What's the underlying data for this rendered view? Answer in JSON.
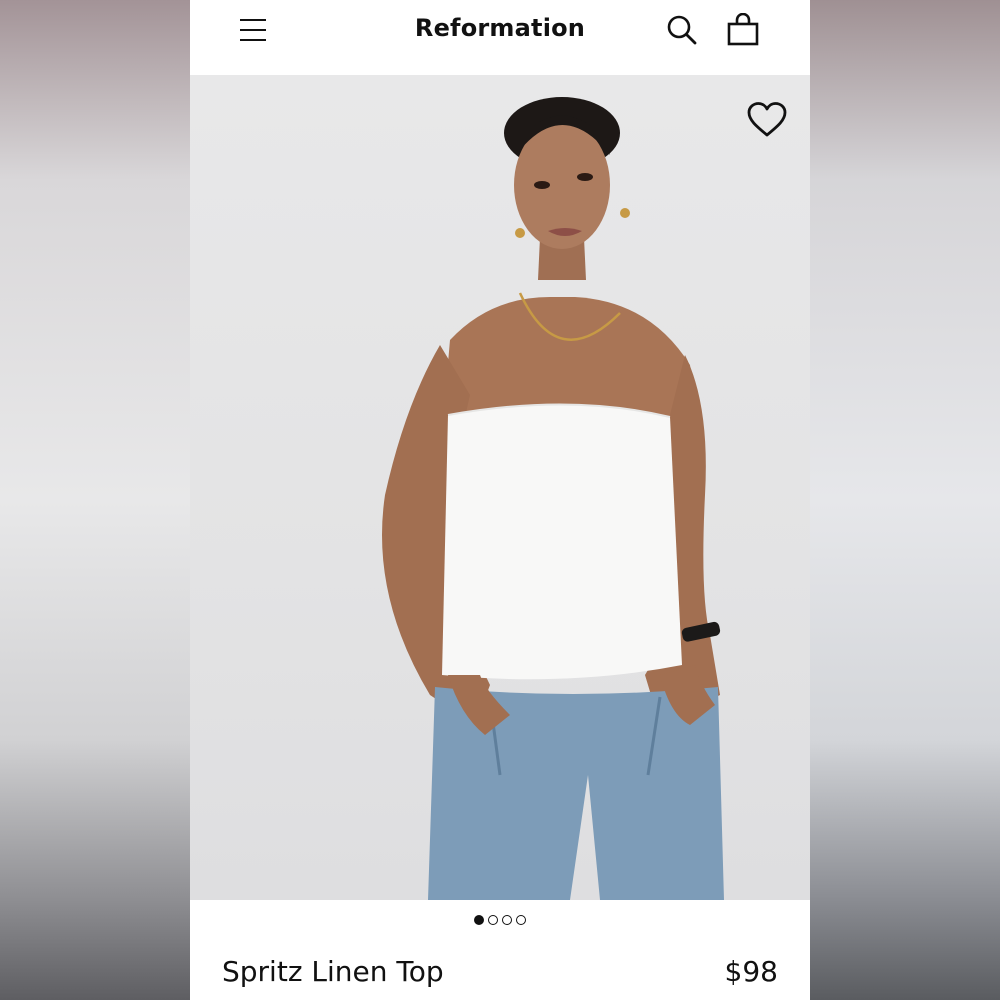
{
  "header": {
    "brand": "Reformation",
    "menu_icon": "hamburger-menu-icon",
    "search_icon": "search-icon",
    "bag_icon": "shopping-bag-icon"
  },
  "hero": {
    "favorite_icon": "heart-icon",
    "image": "product-photo-model"
  },
  "carousel": {
    "total": 4,
    "active": 1
  },
  "product": {
    "name": "Spritz Linen Top",
    "price": "$98"
  },
  "colors": {
    "text": "#111111",
    "background": "#ffffff"
  }
}
